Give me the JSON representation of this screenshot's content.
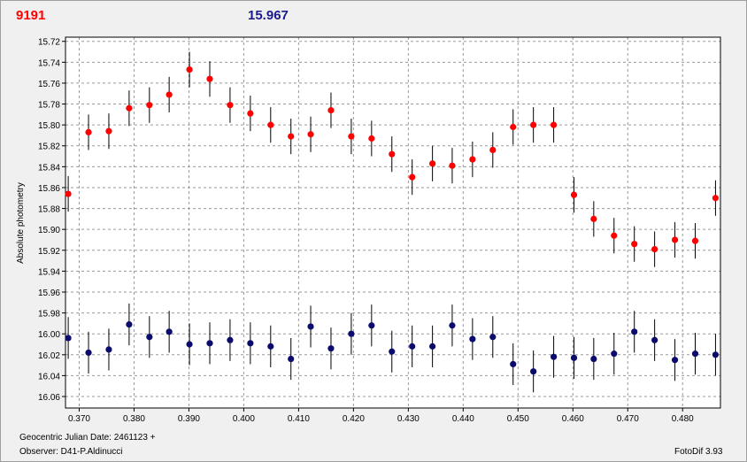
{
  "header": {
    "left_value": "9191",
    "mid_value": "15.967"
  },
  "footer": {
    "julian_date": "Geocentric Julian Date: 2461123 +",
    "observer": "Observer: D41-P.Aldinucci",
    "software": "FotoDif 3.93"
  },
  "colors": {
    "target": "#ff0000",
    "comparison": "#0b0b6e",
    "errorbar": "#000000",
    "grid": "#9a9a9a"
  },
  "chart_data": {
    "type": "scatter",
    "ylabel": "Absolute photometry",
    "xlabel": "",
    "xlim": [
      0.3675,
      0.4869
    ],
    "ylim": [
      16.071,
      15.716
    ],
    "y_inverted": true,
    "grid": true,
    "x_ticks": [
      "0.370",
      "0.380",
      "0.390",
      "0.400",
      "0.410",
      "0.420",
      "0.430",
      "0.440",
      "0.450",
      "0.460",
      "0.470",
      "0.480"
    ],
    "y_ticks": [
      "15.72",
      "15.74",
      "15.76",
      "15.78",
      "15.80",
      "15.82",
      "15.84",
      "15.86",
      "15.88",
      "15.90",
      "15.92",
      "15.94",
      "15.96",
      "15.98",
      "16.00",
      "16.02",
      "16.04",
      "16.06"
    ],
    "series": [
      {
        "color": "#ff0000",
        "error": 0.017,
        "points": [
          [
            0.368,
            15.866
          ],
          [
            0.3717,
            15.807
          ],
          [
            0.3754,
            15.806
          ],
          [
            0.3791,
            15.784
          ],
          [
            0.3828,
            15.781
          ],
          [
            0.3864,
            15.771
          ],
          [
            0.3901,
            15.747
          ],
          [
            0.3938,
            15.756
          ],
          [
            0.3975,
            15.781
          ],
          [
            0.4012,
            15.789
          ],
          [
            0.4049,
            15.8
          ],
          [
            0.4086,
            15.811
          ],
          [
            0.4122,
            15.809
          ],
          [
            0.4159,
            15.786
          ],
          [
            0.4196,
            15.811
          ],
          [
            0.4233,
            15.813
          ],
          [
            0.427,
            15.828
          ],
          [
            0.4307,
            15.85
          ],
          [
            0.4344,
            15.837
          ],
          [
            0.438,
            15.839
          ],
          [
            0.4417,
            15.833
          ],
          [
            0.4454,
            15.824
          ],
          [
            0.4491,
            15.802
          ],
          [
            0.4528,
            15.8
          ],
          [
            0.4565,
            15.8
          ],
          [
            0.4602,
            15.867
          ],
          [
            0.4638,
            15.89
          ],
          [
            0.4675,
            15.906
          ],
          [
            0.4712,
            15.914
          ],
          [
            0.4749,
            15.919
          ],
          [
            0.4786,
            15.91
          ],
          [
            0.4823,
            15.911
          ],
          [
            0.486,
            15.87
          ]
        ]
      },
      {
        "color": "#0b0b6e",
        "error": 0.02,
        "points": [
          [
            0.368,
            16.004
          ],
          [
            0.3717,
            16.018
          ],
          [
            0.3754,
            16.015
          ],
          [
            0.3791,
            15.991
          ],
          [
            0.3828,
            16.003
          ],
          [
            0.3864,
            15.998
          ],
          [
            0.3901,
            16.01
          ],
          [
            0.3938,
            16.009
          ],
          [
            0.3975,
            16.006
          ],
          [
            0.4012,
            16.009
          ],
          [
            0.4049,
            16.012
          ],
          [
            0.4086,
            16.024
          ],
          [
            0.4122,
            15.993
          ],
          [
            0.4159,
            16.014
          ],
          [
            0.4196,
            16.0
          ],
          [
            0.4233,
            15.992
          ],
          [
            0.427,
            16.017
          ],
          [
            0.4307,
            16.012
          ],
          [
            0.4344,
            16.012
          ],
          [
            0.438,
            15.992
          ],
          [
            0.4417,
            16.005
          ],
          [
            0.4454,
            16.003
          ],
          [
            0.4491,
            16.029
          ],
          [
            0.4528,
            16.036
          ],
          [
            0.4565,
            16.022
          ],
          [
            0.4602,
            16.023
          ],
          [
            0.4638,
            16.024
          ],
          [
            0.4675,
            16.019
          ],
          [
            0.4712,
            15.998
          ],
          [
            0.4749,
            16.006
          ],
          [
            0.4786,
            16.025
          ],
          [
            0.4823,
            16.019
          ],
          [
            0.486,
            16.02
          ]
        ]
      }
    ]
  }
}
